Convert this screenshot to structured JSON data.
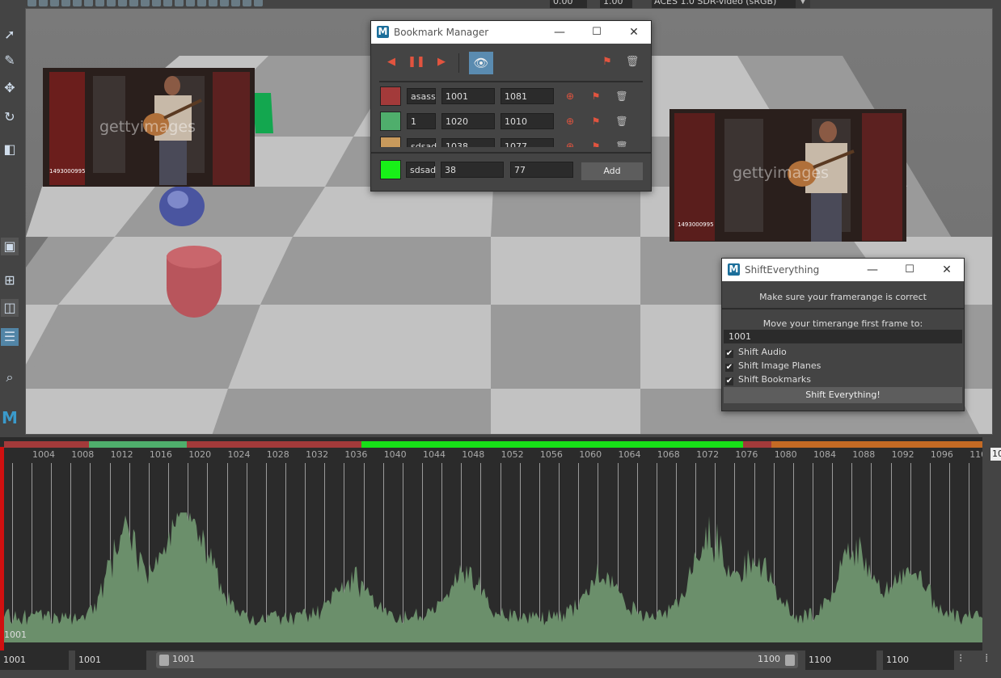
{
  "toolbar": {
    "value1": "0.00",
    "value2": "1.00",
    "colorspace": "ACES 1.0 SDR-video (sRGB)"
  },
  "viewport": {
    "photo_watermark": "gettyimages",
    "photo_id": "1493000995"
  },
  "bookmark_manager": {
    "title": "Bookmark Manager",
    "controls": {
      "minimize": "—",
      "maximize": "☐",
      "close": "✕"
    },
    "bookmarks": [
      {
        "color": "#a33a3a",
        "name": "asass",
        "start": "1001",
        "end": "1081"
      },
      {
        "color": "#4fae6c",
        "name": "1",
        "start": "1020",
        "end": "1010"
      },
      {
        "color": "#c89a5c",
        "name": "sdsad",
        "start": "1038",
        "end": "1077"
      }
    ],
    "new_bookmark": {
      "color": "#18f018",
      "name": "sdsad",
      "start": "38",
      "end": "77"
    },
    "add_label": "Add"
  },
  "shift_everything": {
    "title": "ShiftEverything",
    "controls": {
      "minimize": "—",
      "maximize": "☐",
      "close": "✕"
    },
    "framerange_msg": "Make sure your framerange is correct",
    "move_label": "Move your timerange first frame to:",
    "first_frame": "1001",
    "checks": [
      {
        "label": "Shift Audio",
        "checked": true
      },
      {
        "label": "Shift Image Planes",
        "checked": true
      },
      {
        "label": "Shift Bookmarks",
        "checked": true
      }
    ],
    "button_label": "Shift Everything!"
  },
  "timeline": {
    "ticks": [
      "1004",
      "1008",
      "1012",
      "1016",
      "1020",
      "1024",
      "1028",
      "1032",
      "1036",
      "1040",
      "1044",
      "1048",
      "1052",
      "1056",
      "1060",
      "1064",
      "1068",
      "1072",
      "1076",
      "1080",
      "1084",
      "1088",
      "1092",
      "1096",
      "110"
    ],
    "current_frame": "1001",
    "right_label": "10",
    "bookmark_colors": {
      "red": "#a33a3a",
      "green": "#4fae6c",
      "lime": "#18e018",
      "orange": "#c46a24"
    }
  },
  "range": {
    "anim_start": "1001",
    "start": "1001",
    "slider_start": "1001",
    "slider_end": "1100",
    "end": "1100",
    "anim_end": "1100"
  }
}
